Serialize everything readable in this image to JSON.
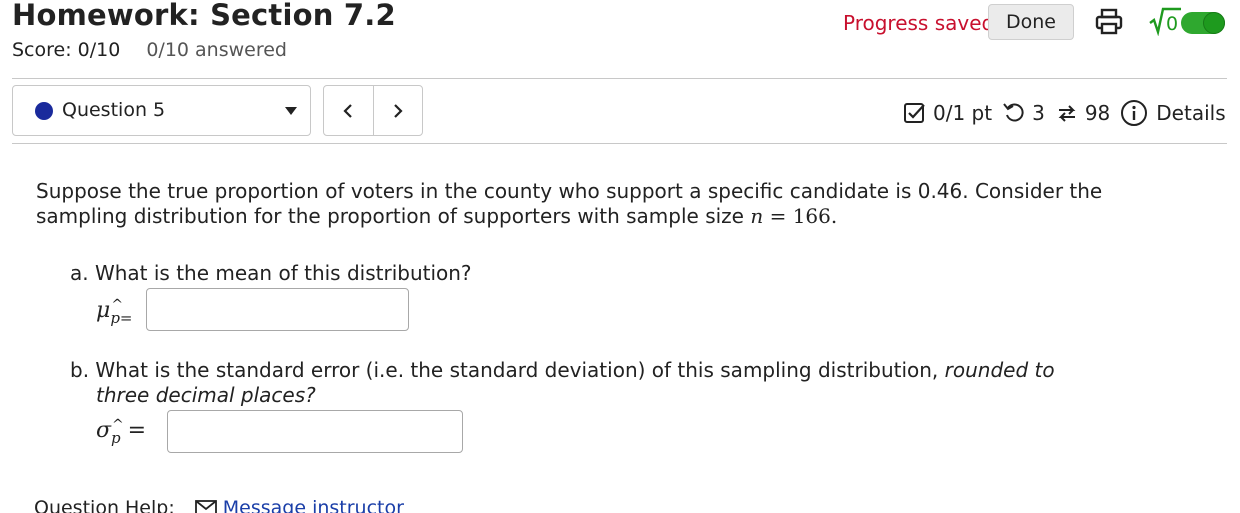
{
  "header": {
    "title": "Homework: Section 7.2",
    "score": "Score: 0/10",
    "answered": "0/10 answered",
    "progress_status": "Progress saved",
    "done_label": "Done",
    "sqrt_label": "√0",
    "toggle_on": true
  },
  "question_nav": {
    "question_label": "Question 5",
    "prev_icon": "chevron-left-icon",
    "next_icon": "chevron-right-icon"
  },
  "meta": {
    "points": "0/1 pt",
    "retries": "3",
    "attempts": "98",
    "details_label": "Details"
  },
  "question": {
    "prompt_line1": "Suppose the true proportion of voters in the county who support a specific candidate is 0.46. Consider the",
    "prompt_line2": "sampling distribution for the proportion of supporters with sample size",
    "n_var": "n",
    "n_eq": "=",
    "n_value": "166",
    "n_period": ".",
    "part_a": "a. What is the mean of this distribution?",
    "mu_symbol": "μ",
    "p_hat": "p",
    "equals": "=",
    "part_b_1": "b. What is the standard error (i.e. the standard deviation) of this sampling distribution,",
    "part_b_ital1": "rounded to",
    "part_b_ital2": "three decimal places?",
    "sigma_symbol": "σ"
  },
  "inputs": {
    "mean_value": "",
    "se_value": ""
  },
  "help": {
    "label": "Question Help:",
    "message_link": "Message instructor"
  },
  "colors": {
    "progress": "#c8102e",
    "accent_dot": "#1a2a9c",
    "toggle": "#2fa82f",
    "link": "#1a3ea8"
  }
}
